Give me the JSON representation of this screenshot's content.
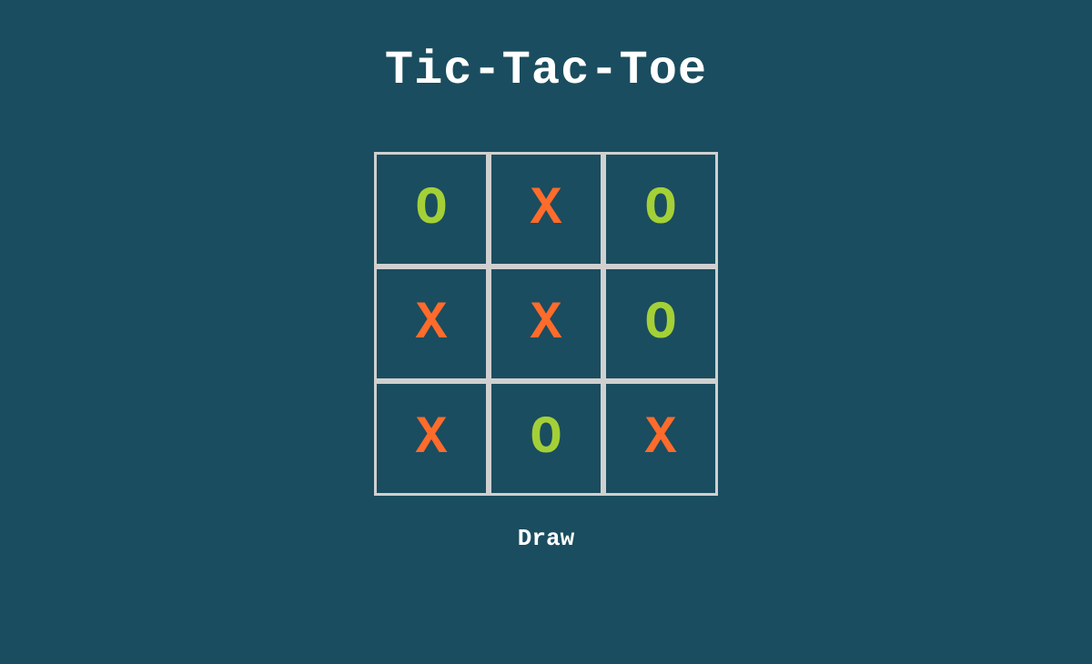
{
  "title": "Tic-Tac-Toe",
  "status": "Draw",
  "colors": {
    "background": "#1a4d5f",
    "grid": "#d0d0d0",
    "x": "#ff6b2b",
    "o": "#a4d037",
    "text": "#ffffff"
  },
  "board": {
    "cells": [
      {
        "value": "O",
        "player": "o"
      },
      {
        "value": "X",
        "player": "x"
      },
      {
        "value": "O",
        "player": "o"
      },
      {
        "value": "X",
        "player": "x"
      },
      {
        "value": "X",
        "player": "x"
      },
      {
        "value": "O",
        "player": "o"
      },
      {
        "value": "X",
        "player": "x"
      },
      {
        "value": "O",
        "player": "o"
      },
      {
        "value": "X",
        "player": "x"
      }
    ]
  }
}
